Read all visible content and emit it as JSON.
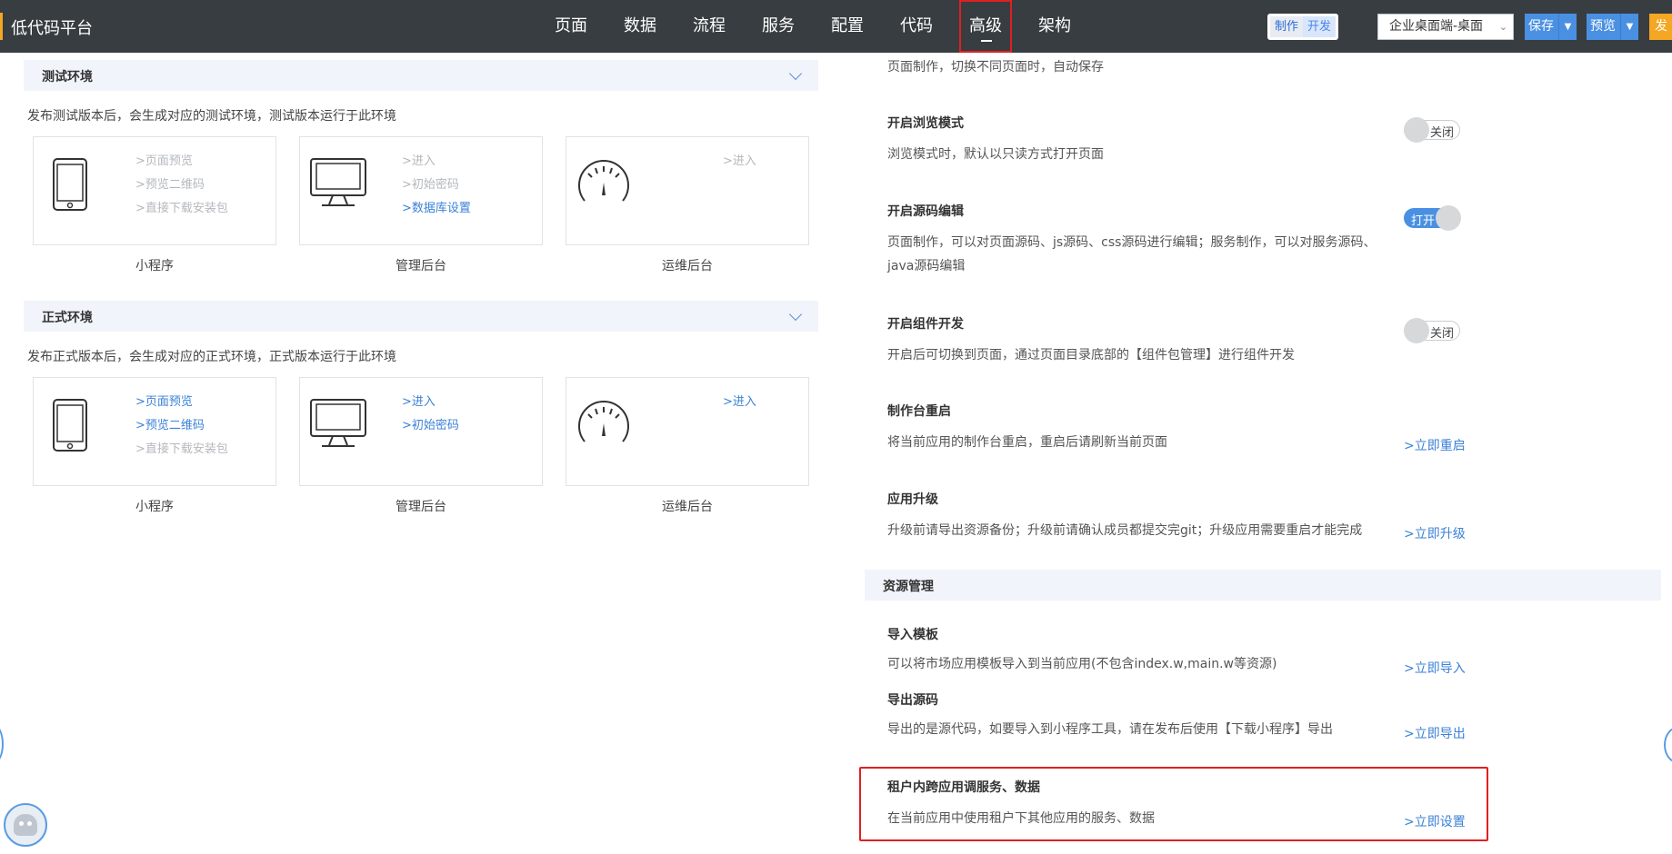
{
  "header": {
    "brand": "低代码平台",
    "nav": [
      {
        "label": "页面"
      },
      {
        "label": "数据"
      },
      {
        "label": "流程"
      },
      {
        "label": "服务"
      },
      {
        "label": "配置"
      },
      {
        "label": "代码"
      },
      {
        "label": "高级",
        "active": true
      },
      {
        "label": "架构"
      }
    ],
    "mode_make": "制作",
    "mode_dev": "开发",
    "target_select": "企业桌面端-桌面",
    "save_label": "保存",
    "preview_label": "预览",
    "publish_label": "发",
    "accent_color": "#4a90e2"
  },
  "test_env": {
    "title": "测试环境",
    "desc": "发布测试版本后，会生成对应的测试环境，测试版本运行于此环境",
    "cards": [
      {
        "caption": "小程序",
        "icon": "mobile-device-icon",
        "links": [
          {
            "label": ">页面预览",
            "enabled": false
          },
          {
            "label": ">预览二维码",
            "enabled": false
          },
          {
            "label": ">直接下载安装包",
            "enabled": false
          }
        ]
      },
      {
        "caption": "管理后台",
        "icon": "monitor-icon",
        "links": [
          {
            "label": ">进入",
            "enabled": false
          },
          {
            "label": ">初始密码",
            "enabled": false
          },
          {
            "label": ">数据库设置",
            "enabled": true
          }
        ]
      },
      {
        "caption": "运维后台",
        "icon": "gauge-icon",
        "links": [
          {
            "label": ">进入",
            "enabled": false
          }
        ]
      }
    ]
  },
  "prod_env": {
    "title": "正式环境",
    "desc": "发布正式版本后，会生成对应的正式环境，正式版本运行于此环境",
    "cards": [
      {
        "caption": "小程序",
        "icon": "mobile-device-icon",
        "links": [
          {
            "label": ">页面预览",
            "enabled": true
          },
          {
            "label": ">预览二维码",
            "enabled": true
          },
          {
            "label": ">直接下载安装包",
            "enabled": false
          }
        ]
      },
      {
        "caption": "管理后台",
        "icon": "monitor-icon",
        "links": [
          {
            "label": ">进入",
            "enabled": true
          },
          {
            "label": ">初始密码",
            "enabled": true
          }
        ]
      },
      {
        "caption": "运维后台",
        "icon": "gauge-icon",
        "links": [
          {
            "label": ">进入",
            "enabled": true
          }
        ]
      }
    ]
  },
  "settings": {
    "top_desc": "页面制作，切换不同页面时，自动保存",
    "browse_mode": {
      "title": "开启浏览模式",
      "desc": "浏览模式时，默认以只读方式打开页面",
      "state": "关闭"
    },
    "source_edit": {
      "title": "开启源码编辑",
      "desc_1": "页面制作，可以对页面源码、js源码、css源码进行编辑；服务制作，可以对服务源码、",
      "desc_2": "java源码编辑",
      "state": "打开"
    },
    "component_dev": {
      "title": "开启组件开发",
      "desc": "开启后可切换到页面，通过页面目录底部的【组件包管理】进行组件开发",
      "state": "关闭"
    },
    "restart": {
      "title": "制作台重启",
      "desc": "将当前应用的制作台重启，重启后请刷新当前页面",
      "link": ">立即重启"
    },
    "upgrade": {
      "title": "应用升级",
      "desc": "升级前请导出资源备份；升级前请确认成员都提交完git；升级应用需要重启才能完成",
      "link": ">立即升级"
    }
  },
  "resources": {
    "title": "资源管理",
    "import": {
      "title": "导入模板",
      "desc": "可以将市场应用模板导入到当前应用(不包含index.w,main.w等资源)",
      "link": ">立即导入"
    },
    "export": {
      "title": "导出源码",
      "desc": "导出的是源代码，如要导入到小程序工具，请在发布后使用【下载小程序】导出",
      "link": ">立即导出"
    },
    "cross_app": {
      "title": "租户内跨应用调服务、数据",
      "desc": "在当前应用中使用租户下其他应用的服务、数据",
      "link": ">立即设置"
    }
  }
}
